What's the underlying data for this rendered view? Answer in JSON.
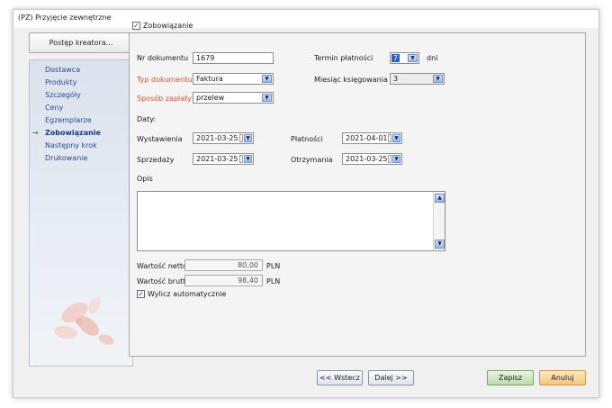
{
  "window": {
    "title": "(PZ) Przyjęcie zewnętrzne"
  },
  "wizard": {
    "header_button": "Postęp kreatora...",
    "steps": [
      {
        "label": "Dostawca",
        "active": false
      },
      {
        "label": "Produkty",
        "active": false
      },
      {
        "label": "Szczegóły",
        "active": false
      },
      {
        "label": "Ceny",
        "active": false
      },
      {
        "label": "Egzemplarze",
        "active": false
      },
      {
        "label": "Zobowiązanie",
        "active": true,
        "marker": "→"
      },
      {
        "label": "Następny krok",
        "active": false
      },
      {
        "label": "Drukowanie",
        "active": false
      }
    ]
  },
  "form": {
    "obligation_checkbox": {
      "label": "Zobowiązanie",
      "checked": true,
      "mark": "✓"
    },
    "nr_dokumentu": {
      "label": "Nr dokumentu",
      "value": "1679"
    },
    "typ_dokumentu": {
      "label": "Typ dokumentu",
      "value": "Faktura"
    },
    "sposob_zaplaty": {
      "label": "Sposób zapłaty",
      "value": "przelew"
    },
    "termin_platnosci": {
      "label": "Termin płatności",
      "value": "7",
      "unit": "dni"
    },
    "miesiac_ksiegowania": {
      "label": "Miesiąc księgowania",
      "value": "3"
    },
    "daty_heading": "Daty:",
    "wystawienia": {
      "label": "Wystawienia",
      "value": "2021-03-25"
    },
    "platnosci": {
      "label": "Płatności",
      "value": "2021-04-01"
    },
    "sprzedazy": {
      "label": "Sprzedaży",
      "value": "2021-03-25"
    },
    "otrzymania": {
      "label": "Otrzymania",
      "value": "2021-03-25"
    },
    "opis": {
      "label": "Opis",
      "value": ""
    },
    "wartosc_netto": {
      "label": "Wartość netto",
      "value": "80,00",
      "currency": "PLN"
    },
    "wartosc_brutto": {
      "label": "Wartość brutto",
      "value": "98,40",
      "currency": "PLN"
    },
    "auto_checkbox": {
      "label": "Wylicz automatycznie",
      "checked": true,
      "mark": "✓"
    }
  },
  "footer": {
    "back_label": "<< Wstecz",
    "next_label": "Dalej >>",
    "save_label": "Zapisz",
    "cancel_label": "Anuluj"
  },
  "glyphs": {
    "dropdown": "▼",
    "scroll_up": "▲",
    "scroll_down": "▼"
  },
  "colors": {
    "required_label": "#d8512a",
    "active_step": "#173a7c",
    "step_arrow": "#3b9a2a"
  }
}
